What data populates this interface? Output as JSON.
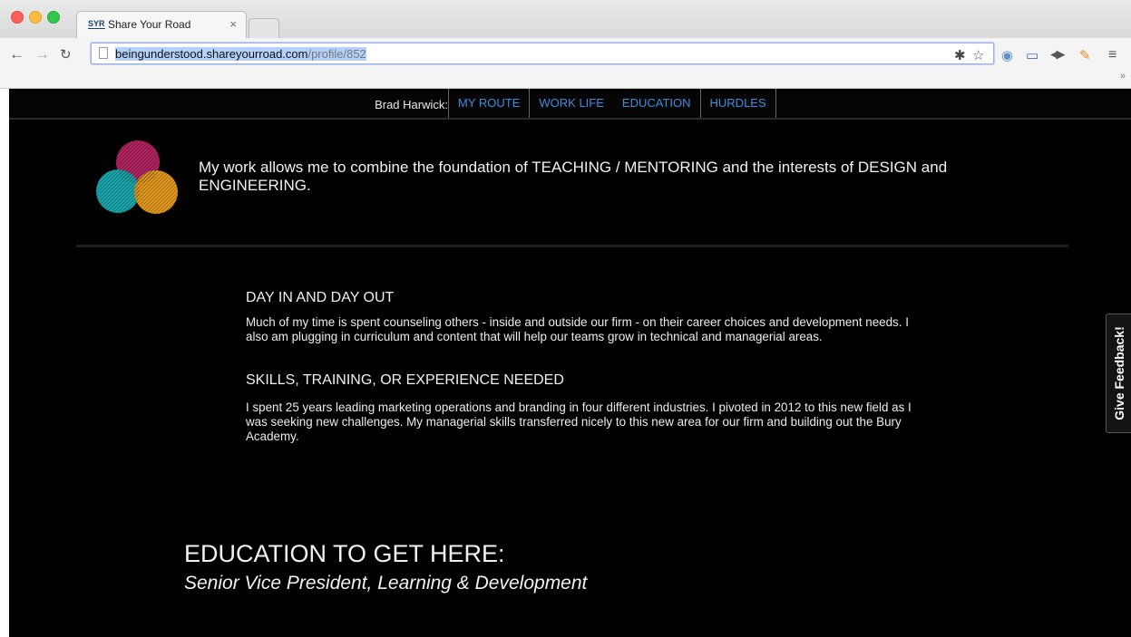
{
  "browser": {
    "tab": {
      "favicon_text": "SYR",
      "title": "Share Your Road",
      "close": "×"
    },
    "address": {
      "url_host": "beingunderstood.shareyourroad.com",
      "url_path": "/profile/852"
    },
    "nav_icons": [
      "back-arrow-icon",
      "forward-arrow-icon",
      "reload-icon"
    ],
    "extension_icons": [
      "bug-icon",
      "star-icon",
      "camera-icon",
      "screen-capture-icon",
      "audio-icon",
      "extension-icon",
      "menu-icon"
    ],
    "overflow": "»"
  },
  "site_nav": {
    "name_label": "Brad Harwick:",
    "links": [
      "MY ROUTE",
      "WORK LIFE",
      "EDUCATION",
      "HURDLES"
    ],
    "link_color": "#3b8fe0"
  },
  "intro": {
    "text": "My work allows me to combine the foundation of TEACHING / MENTORING and the interests of DESIGN and ENGINEERING.",
    "logo_colors": [
      "#b0245f",
      "#1aa6ad",
      "#e39a1c"
    ]
  },
  "sections": [
    {
      "title": "DAY IN AND DAY OUT",
      "body": "Much of my time is spent counseling others - inside and outside our firm - on their career choices and development needs. I also am plugging in curriculum and content that will help our teams grow in technical and managerial areas."
    },
    {
      "title": "SKILLS, TRAINING, OR EXPERIENCE NEEDED",
      "body": "I spent 25 years leading marketing operations and branding in four different industries. I pivoted in 2012 to this new field as I was seeking new challenges. My managerial skills transferred nicely to this new area for our firm and building out the Bury Academy."
    }
  ],
  "education": {
    "heading": "EDUCATION TO GET HERE:",
    "subtitle": "Senior Vice President, Learning & Development"
  },
  "feedback_tab": {
    "label": "Give Feedback!"
  }
}
